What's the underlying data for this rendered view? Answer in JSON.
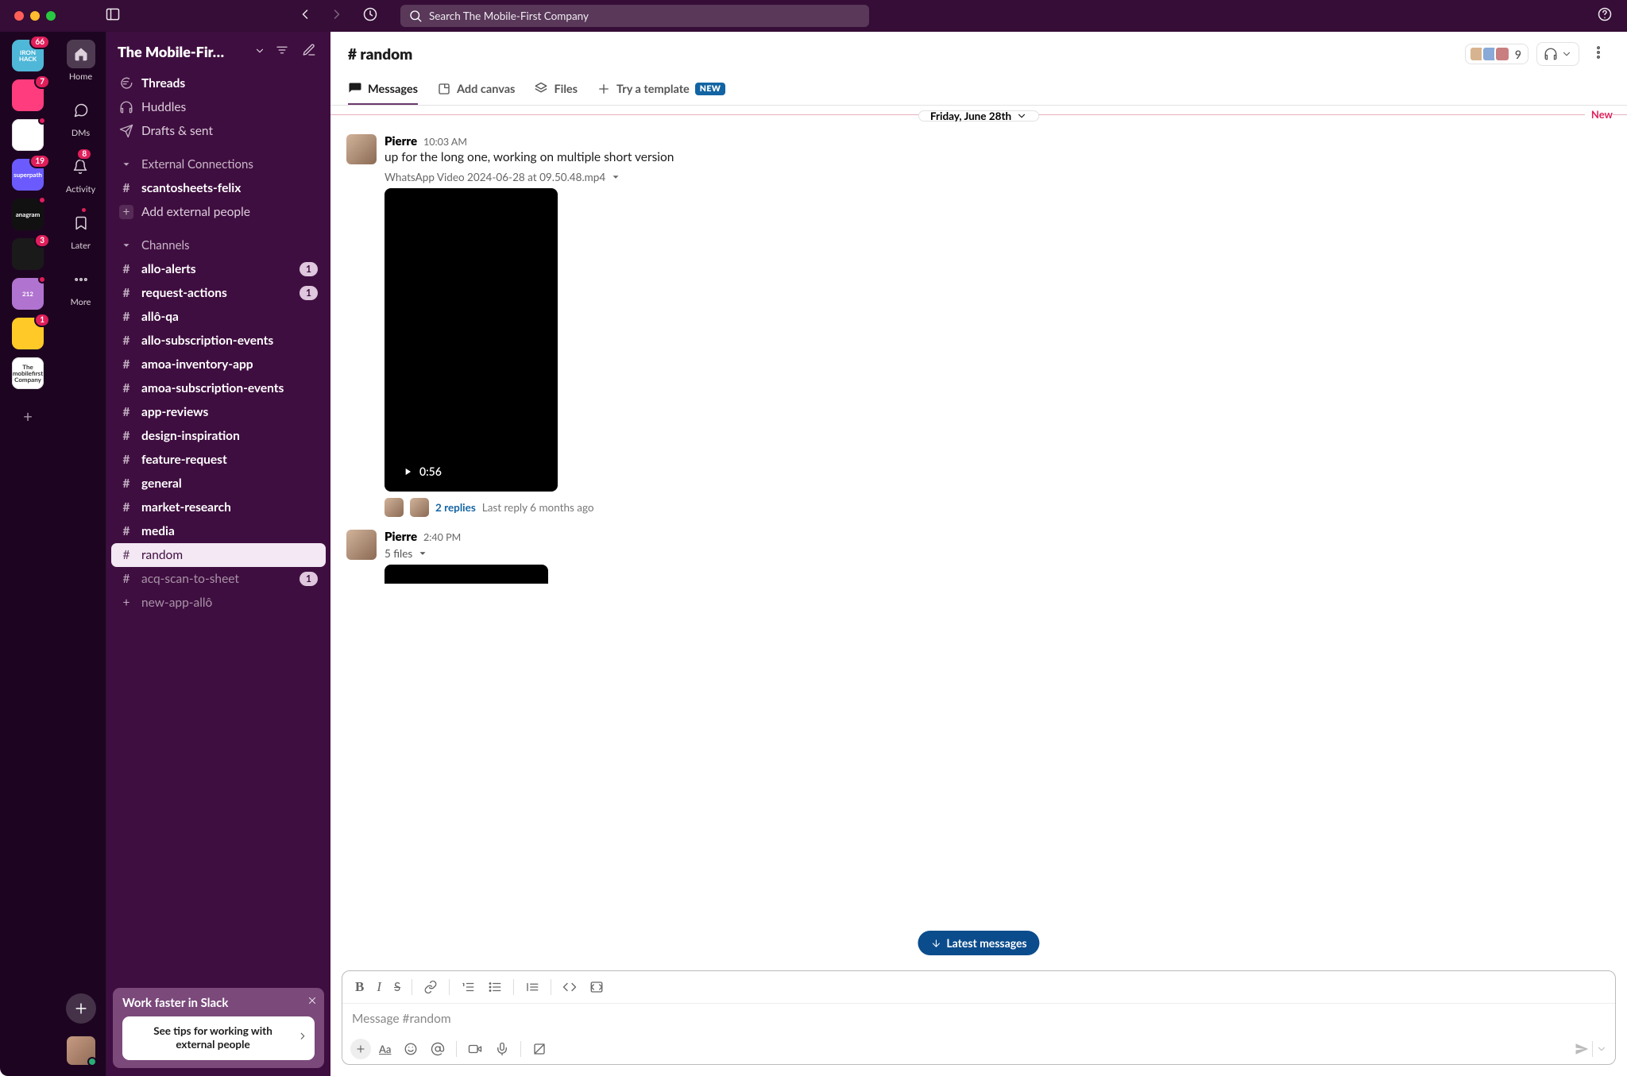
{
  "search": {
    "placeholder": "Search The Mobile-First Company"
  },
  "rail1": [
    {
      "id": "ironhack",
      "label": "IRON HACK",
      "bg": "#4fb7d8",
      "badge": "66"
    },
    {
      "id": "pink",
      "label": "",
      "bg": "#ff3c7d",
      "badge": "7"
    },
    {
      "id": "checks",
      "label": "",
      "bg": "#ffffff",
      "dot": true
    },
    {
      "id": "superpath",
      "label": "superpath",
      "bg": "#6b5bff",
      "badge": "19"
    },
    {
      "id": "anagram",
      "label": "anagram",
      "bg": "#111111",
      "dot": true
    },
    {
      "id": "xred",
      "label": "",
      "bg": "#1a1a1a",
      "badge": "3"
    },
    {
      "id": "stickers",
      "label": "212",
      "bg": "#b073cf",
      "dot": true
    },
    {
      "id": "yellow",
      "label": "",
      "bg": "#ffca28",
      "badge": "1"
    },
    {
      "id": "mobile",
      "label": "The mobilefirst Company",
      "bg": "#ffffff"
    }
  ],
  "rail2": {
    "home": "Home",
    "dms": "DMs",
    "activity": "Activity",
    "activity_badge": "8",
    "later": "Later",
    "more": "More"
  },
  "workspace": {
    "name": "The Mobile-Fir…"
  },
  "nav": {
    "threads": "Threads",
    "huddles": "Huddles",
    "drafts": "Drafts & sent",
    "section_ext": "External Connections",
    "ext_items": [
      {
        "name": "scantosheets-felix",
        "hash": true,
        "bold": true
      }
    ],
    "add_external": "Add external people",
    "section_channels": "Channels",
    "channels": [
      {
        "name": "allo-alerts",
        "bold": true,
        "badge": "1"
      },
      {
        "name": "request-actions",
        "bold": true,
        "badge": "1"
      },
      {
        "name": "allô-qa",
        "bold": true
      },
      {
        "name": "allo-subscription-events",
        "bold": true
      },
      {
        "name": "amoa-inventory-app",
        "bold": true
      },
      {
        "name": "amoa-subscription-events",
        "bold": true
      },
      {
        "name": "app-reviews",
        "bold": true
      },
      {
        "name": "design-inspiration",
        "bold": true
      },
      {
        "name": "feature-request",
        "bold": true
      },
      {
        "name": "general",
        "bold": true
      },
      {
        "name": "market-research",
        "bold": true
      },
      {
        "name": "media",
        "bold": true
      },
      {
        "name": "random",
        "active": true
      },
      {
        "name": "acq-scan-to-sheet",
        "muted": true,
        "badge": "1"
      },
      {
        "name": "new-app-allô",
        "muted": true,
        "plus": true
      }
    ]
  },
  "promo": {
    "title": "Work faster in Slack",
    "card_line1": "See tips for working with",
    "card_line2": "external people"
  },
  "channel_header": {
    "name": "# random",
    "members": "9"
  },
  "tabs": {
    "messages": "Messages",
    "canvas": "Add canvas",
    "files": "Files",
    "template": "Try a template",
    "new_badge": "NEW"
  },
  "newline_label": "New",
  "date_pill": "Friday, June 28th",
  "messages": [
    {
      "author": "Pierre",
      "ts": "10:03 AM",
      "text": "up for the long one, working on multiple short version",
      "attachment": "WhatsApp Video 2024-06-28 at 09.50.48.mp4",
      "duration": "0:56",
      "replies": "2 replies",
      "last_reply": "Last reply 6 months ago"
    },
    {
      "author": "Pierre",
      "ts": "2:40 PM",
      "files_line": "5 files"
    }
  ],
  "latest_button": "Latest messages",
  "composer": {
    "placeholder": "Message #random"
  }
}
